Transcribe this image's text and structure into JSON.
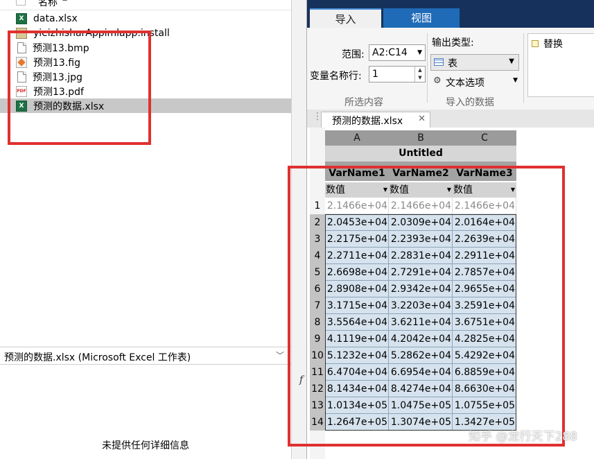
{
  "file_browser": {
    "header": {
      "name_col": "名称"
    },
    "files": [
      {
        "name": "data.xlsx",
        "icon": "excel-file-icon"
      },
      {
        "name": "yieizhisharAppimlapp.install",
        "icon": "mlapp-install-icon"
      },
      {
        "name": "预测13.bmp",
        "icon": "generic-file-icon"
      },
      {
        "name": "预测13.fig",
        "icon": "matlab-figure-icon"
      },
      {
        "name": "预测13.jpg",
        "icon": "generic-file-icon"
      },
      {
        "name": "预测13.pdf",
        "icon": "pdf-file-icon"
      },
      {
        "name": "预测的数据.xlsx",
        "icon": "excel-file-icon",
        "selected": true
      }
    ],
    "details_title": "预测的数据.xlsx  (Microsoft Excel 工作表)",
    "no_details": "未提供任何详细信息"
  },
  "import_tool": {
    "tabs": [
      "导入",
      "视图"
    ],
    "range_label": "范围:",
    "range_value": "A2:C14",
    "varname_row_label": "变量名称行:",
    "varname_row_value": "1",
    "selection_group": "所选内容",
    "output_type_label": "输出类型:",
    "output_type_value": "表",
    "text_options": "文本选项",
    "imported_data_group": "导入的数据",
    "replace_label": "替换",
    "doc_tab": "预测的数据.xlsx",
    "sheet": {
      "columns": [
        "A",
        "B",
        "C"
      ],
      "title": "Untitled",
      "var_names": [
        "VarName1",
        "VarName2",
        "VarName3"
      ],
      "var_types": [
        "数值",
        "数值",
        "数值"
      ],
      "row_numbers": [
        "1",
        "2",
        "3",
        "4",
        "5",
        "6",
        "7",
        "8",
        "9",
        "10",
        "11",
        "12",
        "13",
        "14"
      ],
      "rows": [
        [
          "2.1466e+04",
          "2.1466e+04",
          "2.1466e+04"
        ],
        [
          "2.0453e+04",
          "2.0309e+04",
          "2.0164e+04"
        ],
        [
          "2.2175e+04",
          "2.2393e+04",
          "2.2639e+04"
        ],
        [
          "2.2711e+04",
          "2.2831e+04",
          "2.2911e+04"
        ],
        [
          "2.6698e+04",
          "2.7291e+04",
          "2.7857e+04"
        ],
        [
          "2.8908e+04",
          "2.9342e+04",
          "2.9655e+04"
        ],
        [
          "3.1715e+04",
          "3.2203e+04",
          "3.2591e+04"
        ],
        [
          "3.5564e+04",
          "3.6211e+04",
          "3.6751e+04"
        ],
        [
          "4.1119e+04",
          "4.2042e+04",
          "4.2825e+04"
        ],
        [
          "5.1232e+04",
          "5.2862e+04",
          "5.4292e+04"
        ],
        [
          "6.4704e+04",
          "6.6954e+04",
          "6.8859e+04"
        ],
        [
          "8.1434e+04",
          "8.4274e+04",
          "8.6630e+04"
        ],
        [
          "1.0134e+05",
          "1.0475e+05",
          "1.0755e+05"
        ],
        [
          "1.2647e+05",
          "1.3074e+05",
          "1.3427e+05"
        ]
      ]
    }
  },
  "watermark": "知乎 @龙行天下288",
  "colors": {
    "annotation_red": "#e03030",
    "ribbon_dark": "#16325c",
    "selection_blue": "#d6e3ee"
  }
}
